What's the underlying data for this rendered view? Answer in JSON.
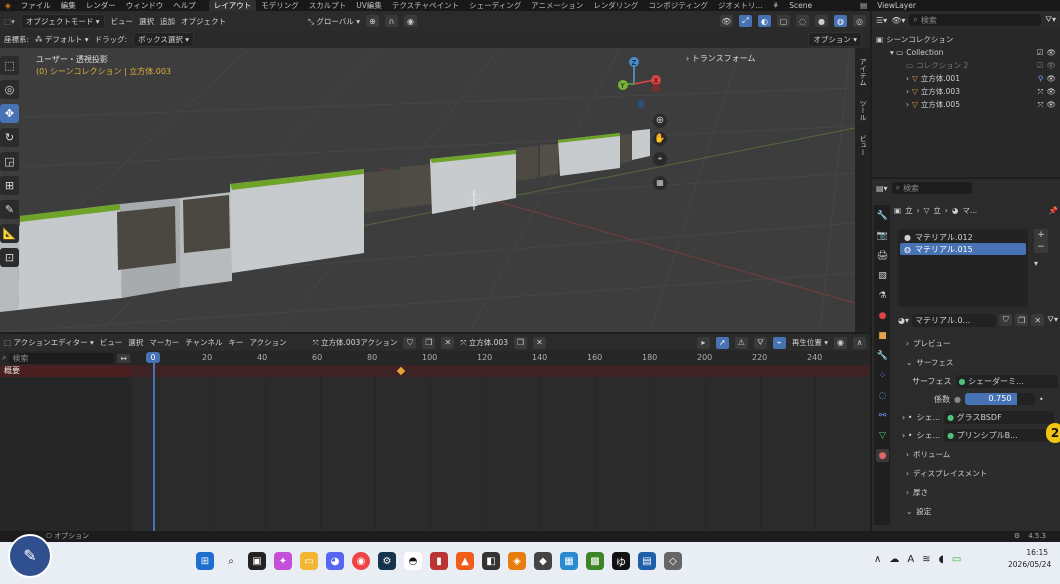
{
  "menubar": {
    "items": [
      "ファイル",
      "編集",
      "レンダー",
      "ウィンドウ",
      "ヘルプ"
    ],
    "workspaces": [
      "レイアウト",
      "モデリング",
      "スカルプト",
      "UV編集",
      "テクスチャペイント",
      "シェーディング",
      "アニメーション",
      "レンダリング",
      "コンポジティング",
      "ジオメトリ..."
    ],
    "active_workspace": "レイアウト",
    "scene": "Scene",
    "view_layer": "ViewLayer"
  },
  "viewport_header": {
    "mode": "オブジェクトモード",
    "menus": [
      "ビュー",
      "選択",
      "追加",
      "オブジェクト"
    ],
    "transform_orientation": "グローバル",
    "options_label": "オプション"
  },
  "tool_settings": {
    "coord_label": "座標系:",
    "pivot_value": "デフォルト",
    "drag_label": "ドラッグ:",
    "drag_value": "ボックス選択"
  },
  "viewport": {
    "view_name": "ユーザー・透視投影",
    "collection_info": "(0) シーンコレクション | 立方体.003",
    "transform_panel": "トランスフォーム",
    "side_tabs": [
      "アイテム",
      "ツール",
      "ビュー"
    ],
    "gizmo_axes": [
      "Z",
      "X",
      "Y"
    ]
  },
  "action_editor": {
    "editor_type": "アクションエディター",
    "menus": [
      "ビュー",
      "選択",
      "マーカー",
      "チャンネル",
      "キー",
      "アクション"
    ],
    "action_name": "立方体.003アクション",
    "object_name": "立方体.003",
    "playhead_label": "再生位置",
    "search_placeholder": "検索",
    "channel_summary": "概要",
    "current_frame": "0",
    "frame_ticks": [
      "20",
      "40",
      "60",
      "80",
      "100",
      "120",
      "140",
      "160",
      "180",
      "200",
      "220",
      "240"
    ],
    "keyframe_at": 90
  },
  "outliner": {
    "search_placeholder": "検索",
    "root": "シーンコレクション",
    "collection": "Collection",
    "items": [
      "コレクション 2",
      "立方体.001",
      "立方体.003",
      "立方体.005"
    ]
  },
  "properties": {
    "search_placeholder": "検索",
    "breadcrumb": [
      "立",
      "立",
      "マ..."
    ],
    "materials": [
      "マテリアル.012",
      "マテリアル.015"
    ],
    "selected_material_index": 1,
    "material_field": "マテリアル.0...",
    "sections": {
      "preview": "プレビュー",
      "surface": "サーフェス",
      "volume": "ボリューム",
      "displacement": "ディスプレイスメント",
      "thickness": "厚さ",
      "settings": "設定"
    },
    "surface_label": "サーフェス",
    "surface_value": "シェーダーミ...",
    "factor_label": "係数",
    "factor_value": "0.750",
    "factor_fraction": 0.75,
    "shader1_label": "シェ...",
    "shader1_value": "グラスBSDF",
    "shader2_label": "シェ...",
    "shader2_value": "プリンシプルB..."
  },
  "status_bar": {
    "options": "オプション",
    "version": "4.5.3"
  },
  "taskbar": {
    "time": "16:15",
    "date": "2026/05/24",
    "badge": "2",
    "tray_char": "A"
  }
}
